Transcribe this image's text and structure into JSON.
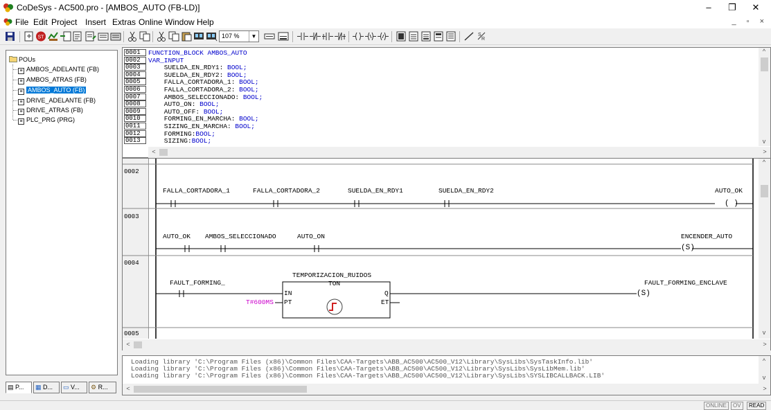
{
  "window": {
    "title": "CoDeSys - AC500.pro - [AMBOS_AUTO (FB-LD)]",
    "controls": {
      "minimize": "–",
      "restore": "❐",
      "close": "✕"
    }
  },
  "menu": {
    "items": [
      "File",
      "Edit",
      "Project",
      "Insert",
      "Extras",
      "Online",
      "Window",
      "Help"
    ],
    "mdi_controls": "_ ▫ ×"
  },
  "toolbar": {
    "zoom": "107 %"
  },
  "pou_tree": {
    "root": "POUs",
    "items": [
      {
        "label": "AMBOS_ADELANTE (FB)",
        "selected": false
      },
      {
        "label": "AMBOS_ATRAS (FB)",
        "selected": false
      },
      {
        "label": "AMBOS_AUTO (FB)",
        "selected": true
      },
      {
        "label": "DRIVE_ADELANTE (FB)",
        "selected": false
      },
      {
        "label": "DRIVE_ATRAS (FB)",
        "selected": false
      },
      {
        "label": "PLC_PRG (PRG)",
        "selected": false
      }
    ]
  },
  "object_tabs": [
    "P...",
    "D...",
    "V...",
    "R..."
  ],
  "declaration": {
    "lines": [
      {
        "no": "0001",
        "text": "FUNCTION_BLOCK AMBOS_AUTO",
        "kind": "kw"
      },
      {
        "no": "0002",
        "text": "VAR_INPUT",
        "kind": "kw"
      },
      {
        "no": "0003",
        "name": "    SUELDA_EN_RDY1: ",
        "type": "BOOL;"
      },
      {
        "no": "0004",
        "name": "    SUELDA_EN_RDY2: ",
        "type": "BOOL;"
      },
      {
        "no": "0005",
        "name": "    FALLA_CORTADORA_1: ",
        "type": "BOOL;"
      },
      {
        "no": "0006",
        "name": "    FALLA_CORTADORA_2: ",
        "type": "BOOL;"
      },
      {
        "no": "0007",
        "name": "    AMBOS_SELECCIONADO: ",
        "type": "BOOL;"
      },
      {
        "no": "0008",
        "name": "    AUTO_ON: ",
        "type": "BOOL;"
      },
      {
        "no": "0009",
        "name": "    AUTO_OFF: ",
        "type": "BOOL;"
      },
      {
        "no": "0010",
        "name": "    FORMING_EN_MARCHA: ",
        "type": "BOOL;"
      },
      {
        "no": "0011",
        "name": "    SIZING_EN_MARCHA: ",
        "type": "BOOL;"
      },
      {
        "no": "0012",
        "name": "    FORMING:",
        "type": "BOOL;"
      },
      {
        "no": "0013",
        "name": "    SIZING:",
        "type": "BOOL;"
      }
    ]
  },
  "ladder": {
    "networks": [
      {
        "no": "0002",
        "contacts": [
          "FALLA_CORTADORA_1",
          "FALLA_CORTADORA_2",
          "SUELDA_EN_RDY1",
          "SUELDA_EN_RDY2"
        ],
        "coil": {
          "name": "AUTO_OK",
          "symbol": "( )"
        }
      },
      {
        "no": "0003",
        "contacts": [
          "AUTO_OK",
          "AMBOS_SELECCIONADO",
          "AUTO_ON"
        ],
        "coil": {
          "name": "ENCENDER_AUTO",
          "symbol": "(S)"
        }
      },
      {
        "no": "0004",
        "contacts": [
          "FAULT_FORMING_"
        ],
        "block": {
          "instance": "TEMPORIZACION_RUIDOS",
          "type": "TON",
          "in": "IN",
          "pt": "PT",
          "q": "Q",
          "et": "ET",
          "pt_value": "T#600MS"
        },
        "coil": {
          "name": "FAULT_FORMING_ENCLAVE",
          "symbol": "(S)"
        }
      },
      {
        "no": "0005"
      }
    ],
    "colors": {
      "constant": "#cc00cc"
    }
  },
  "messages": [
    "Loading library 'C:\\Program Files (x86)\\Common Files\\CAA-Targets\\ABB_AC500\\AC500_V12\\Library\\SysLibs\\SysTaskInfo.lib'",
    "Loading library 'C:\\Program Files (x86)\\Common Files\\CAA-Targets\\ABB_AC500\\AC500_V12\\Library\\SysLibs\\SysLibMem.lib'",
    "Loading library 'C:\\Program Files (x86)\\Common Files\\CAA-Targets\\ABB_AC500\\AC500_V12\\Library\\SysLibs\\SYSLIBCALLBACK.LIB'"
  ],
  "status": {
    "online": "ONLINE",
    "ov": "OV",
    "read": "READ"
  }
}
